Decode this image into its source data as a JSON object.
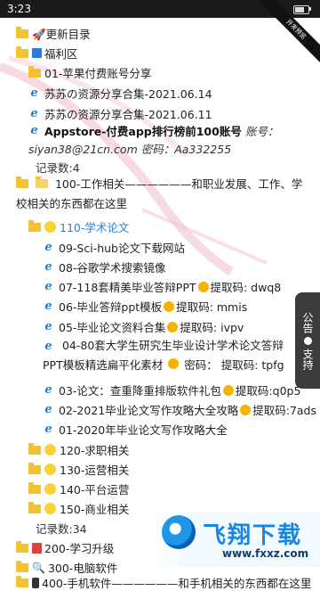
{
  "status_bar": {
    "time": "3:23"
  },
  "ribbon_text": "开发预览",
  "tree": {
    "update_dir": "🚀更新目录",
    "welfare": "福利区",
    "apple_share": "01-苹果付费账号分享",
    "link_1": "苏苏の资源分享合集-2021.06.14",
    "link_2": "苏苏の资源分享合集-2021.06.11",
    "appstore_bold": "Appstore-付费app排行榜前100账号",
    "appstore_italic_1": "账号：",
    "appstore_italic_2": "siyan38@21cn.com 密码：Aa332255",
    "count_1": "记录数:4",
    "work_folder": "100-工作相关——————和职业发展、工作、学校相关的东西都在这里",
    "thesis": "110-学术论文",
    "thesis_items": [
      "09-Sci-hub论文下载网站",
      "08-谷歌学术搜索镜像",
      "07-118套精美毕业答辩PPT",
      "06-毕业答辩ppt模板",
      "05-毕业论文资料合集",
      "04-80套大学生研究生毕业设计学术论文答辩PPT模板精选扁平化素材",
      "03-论文：查重降重排版软件礼包",
      "02-2021毕业论文写作攻略大全攻略",
      "01-2020年毕业论文写作攻略大全"
    ],
    "codes": {
      "c07": "提取码: dwq8",
      "c06": "提取码: mmis",
      "c05": "提取码: ivpv",
      "c04": "提取码: tpfg",
      "c04_prefix": "密码：",
      "c03": "提取码:q0p5",
      "c02": "提取码:7ads"
    },
    "sub_folders": [
      "120-求职相关",
      "130-运营相关",
      "140-平台运营",
      "150-商业相关"
    ],
    "count_2": "记录数:34",
    "study": "200-学习升级",
    "computer": "300-电脑软件",
    "phone": "400-手机软件——————和手机相关的东西都在这里"
  },
  "side_tab": {
    "top": "公告",
    "bottom": "支持"
  },
  "watermark": {
    "brand": "飞翔下载",
    "url": "www.fxxz.com"
  }
}
